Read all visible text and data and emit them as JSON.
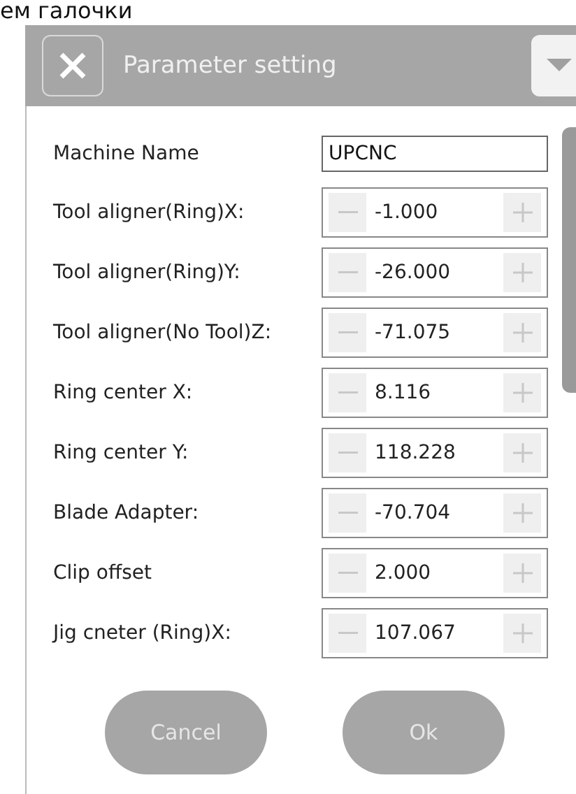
{
  "caption": "ем галочки",
  "dialog": {
    "title": "Parameter setting",
    "machine_name": {
      "label": "Machine Name",
      "value": "UPCNC"
    },
    "parameters": [
      {
        "label": "Tool aligner(Ring)X:",
        "value": "-1.000"
      },
      {
        "label": "Tool aligner(Ring)Y:",
        "value": "-26.000"
      },
      {
        "label": "Tool aligner(No Tool)Z:",
        "value": "-71.075"
      },
      {
        "label": "Ring center X:",
        "value": "8.116"
      },
      {
        "label": "Ring center Y:",
        "value": "118.228"
      },
      {
        "label": "Blade Adapter:",
        "value": "-70.704"
      },
      {
        "label": "Clip offset",
        "value": "2.000"
      },
      {
        "label": "Jig cneter (Ring)X:",
        "value": "107.067"
      }
    ],
    "buttons": [
      "Cancel",
      "Ok"
    ]
  }
}
